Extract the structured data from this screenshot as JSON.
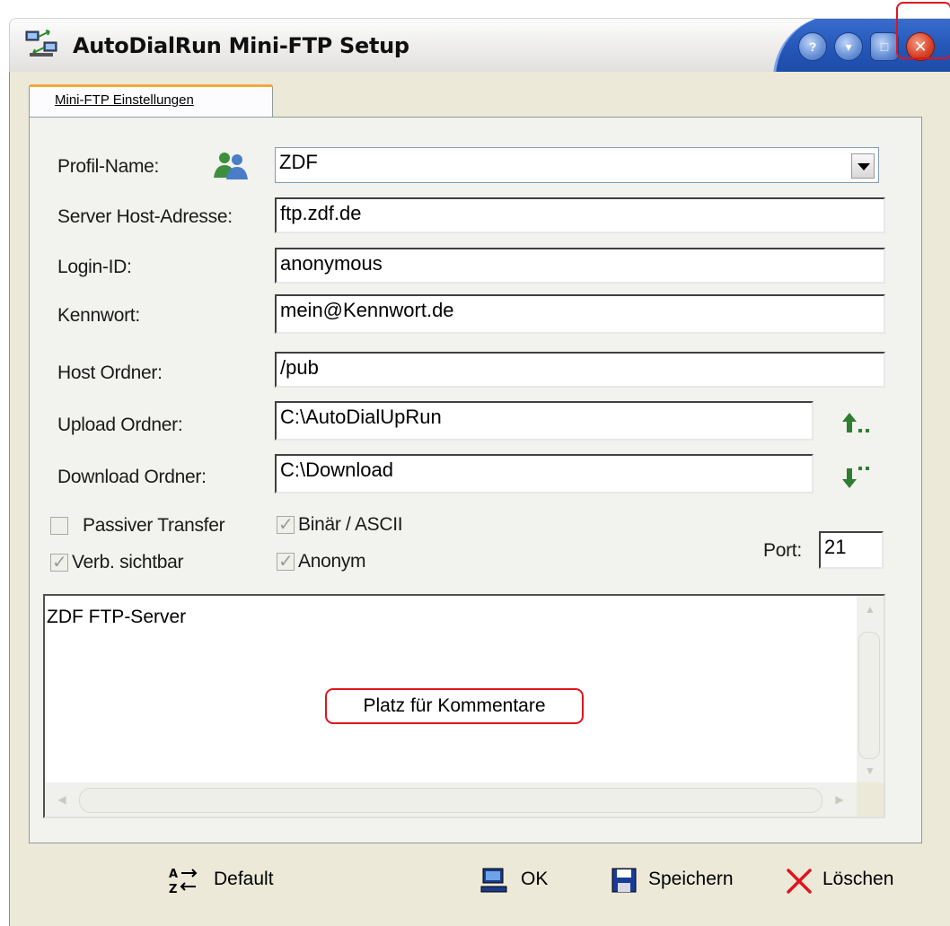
{
  "window": {
    "title": "AutoDialRun Mini-FTP Setup",
    "controls": [
      "help",
      "minimize-to-tray",
      "maximize",
      "close"
    ]
  },
  "tab": {
    "label": "Mini-FTP Einstellungen"
  },
  "form": {
    "profile_label": "Profil-Name:",
    "profile_value": "ZDF",
    "host_label": "Server Host-Adresse:",
    "host_value": "ftp.zdf.de",
    "login_label": "Login-ID:",
    "login_value": "anonymous",
    "password_label": "Kennwort:",
    "password_value": "mein@Kennwort.de",
    "hostdir_label": "Host Ordner:",
    "hostdir_value": "/pub",
    "upload_label": "Upload Ordner:",
    "upload_value": "C:\\AutoDialUpRun",
    "download_label": "Download Ordner:",
    "download_value": "C:\\Download"
  },
  "options": {
    "passive_label": "Passiver Transfer",
    "passive_checked": false,
    "visible_label": "Verb. sichtbar",
    "visible_checked": true,
    "binary_label": "Binär / ASCII",
    "binary_checked": true,
    "anon_label": "Anonym",
    "anon_checked": true,
    "port_label": "Port:",
    "port_value": "21"
  },
  "comment": {
    "text": "ZDF FTP-Server",
    "callout": "Platz für Kommentare"
  },
  "buttons": {
    "default_label": "Default",
    "ok_label": "OK",
    "save_label": "Speichern",
    "delete_label": "Löschen"
  },
  "colors": {
    "accent_blue": "#2457b8",
    "close_red": "#d9452a",
    "highlight_red": "#e0141e",
    "tab_orange": "#f0a83c"
  }
}
